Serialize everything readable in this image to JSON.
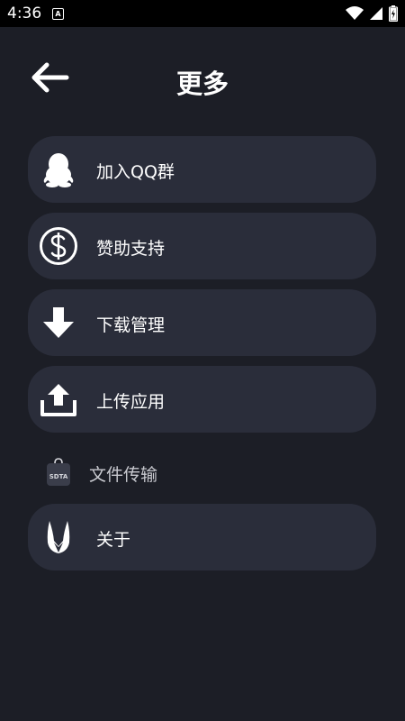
{
  "status_bar": {
    "time": "4:36",
    "notification_glyph": "A"
  },
  "header": {
    "title": "更多"
  },
  "menu": {
    "items": [
      {
        "label": "加入QQ群",
        "icon": "qq-penguin-icon"
      },
      {
        "label": "赞助支持",
        "icon": "dollar-circle-icon"
      },
      {
        "label": "下载管理",
        "icon": "download-arrow-icon"
      },
      {
        "label": "上传应用",
        "icon": "upload-tray-icon"
      }
    ],
    "transfer": {
      "label": "文件传输",
      "icon_text": "SDTA",
      "icon": "sdta-bag-icon"
    },
    "about": {
      "label": "关于",
      "icon": "app-logo-icon"
    }
  },
  "colors": {
    "background": "#1c1e26",
    "card": "#2a2d3a",
    "text": "#ffffff",
    "muted_text": "#c9cad0"
  }
}
